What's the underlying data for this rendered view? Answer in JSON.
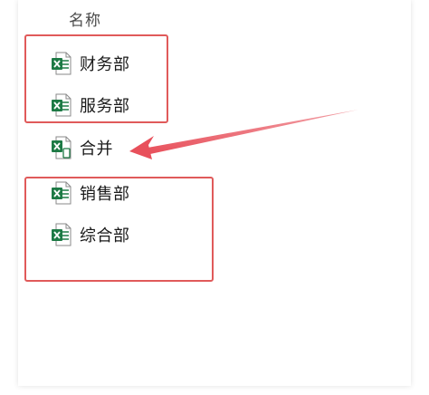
{
  "header": {
    "column_name": "名称"
  },
  "files": [
    {
      "label": "财务部",
      "icon": "excel-file-icon"
    },
    {
      "label": "服务部",
      "icon": "excel-file-icon"
    },
    {
      "label": "合并",
      "icon": "excel-macro-file-icon"
    },
    {
      "label": "销售部",
      "icon": "excel-file-icon"
    },
    {
      "label": "综合部",
      "icon": "excel-file-icon"
    }
  ],
  "colors": {
    "highlight": "#e05a5a",
    "arrow": "#e8505b",
    "excel_green": "#1d7a45"
  }
}
